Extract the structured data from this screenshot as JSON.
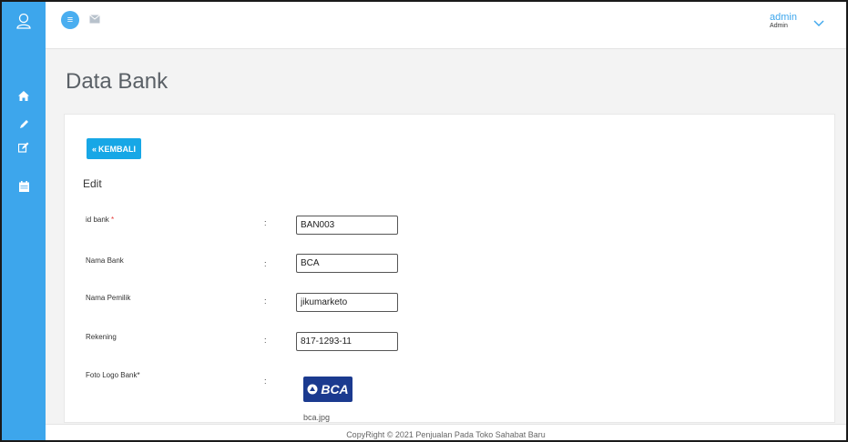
{
  "sidebar": {
    "icons": [
      "user-icon",
      "home-icon",
      "pencil-icon",
      "edit-icon",
      "calendar-icon"
    ]
  },
  "topbar": {
    "menu_icon": "≡",
    "mail_icon": "mail-icon",
    "user_name": "admin",
    "user_role": "Admin"
  },
  "page": {
    "title": "Data Bank"
  },
  "card": {
    "back_label": "KEMBALI",
    "back_icon": "«",
    "section_title": "Edit",
    "fields": [
      {
        "label": "id bank",
        "required": "*",
        "value": "BAN003"
      },
      {
        "label": "Nama Bank",
        "value": "BCA"
      },
      {
        "label": "Nama Pemilik",
        "value": "jikumarketo"
      },
      {
        "label": "Rekening",
        "value": "817-1293-11"
      },
      {
        "label": "Foto Logo Bank*"
      }
    ],
    "colon": ":",
    "logo_text": "BCA",
    "file_name": "bca.jpg"
  },
  "footer": {
    "text": "CopyRight © 2021 Penjualan Pada Toko Sahabat Baru"
  },
  "colors": {
    "sidebar": "#3da6ec",
    "button": "#17a7e6",
    "logo": "#1b3a8f"
  }
}
